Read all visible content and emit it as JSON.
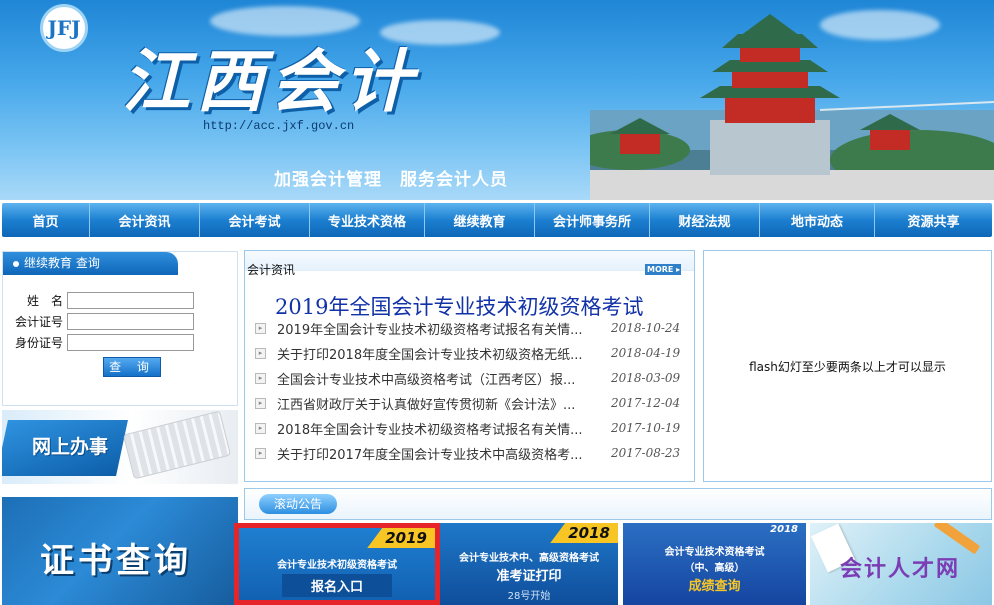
{
  "header": {
    "logo_text": "JFJ",
    "title": "江西会计",
    "url": "http://acc.jxf.gov.cn",
    "slogan": "加强会计管理　服务会计人员"
  },
  "nav": {
    "items": [
      {
        "label": "首页"
      },
      {
        "label": "会计资讯"
      },
      {
        "label": "会计考试"
      },
      {
        "label": "专业技术资格"
      },
      {
        "label": "继续教育"
      },
      {
        "label": "会计师事务所"
      },
      {
        "label": "财经法规"
      },
      {
        "label": "地市动态"
      },
      {
        "label": "资源共享"
      }
    ]
  },
  "query": {
    "title": "继续教育 查询",
    "fields": [
      {
        "label": "姓　名",
        "value": ""
      },
      {
        "label": "会计证号",
        "value": ""
      },
      {
        "label": "身份证号",
        "value": ""
      }
    ],
    "button": "查 询"
  },
  "online_banner": {
    "label": "网上办事"
  },
  "cert_banner": {
    "label": "证书查询"
  },
  "news": {
    "title": "会计资讯",
    "more": "MORE ▸",
    "headline": "2019年全国会计专业技术初级资格考试",
    "items": [
      {
        "title": "2019年全国会计专业技术初级资格考试报名有关情...",
        "date": "2018-10-24"
      },
      {
        "title": "关于打印2018年度全国会计专业技术初级资格无纸...",
        "date": "2018-04-19"
      },
      {
        "title": "全国会计专业技术中高级资格考试（江西考区）报...",
        "date": "2018-03-09"
      },
      {
        "title": "江西省财政厅关于认真做好宣传贯彻新《会计法》...",
        "date": "2017-12-04"
      },
      {
        "title": "2018年全国会计专业技术初级资格考试报名有关情...",
        "date": "2017-10-19"
      },
      {
        "title": "关于打印2017年度全国会计专业技术中高级资格考...",
        "date": "2017-08-23"
      }
    ]
  },
  "flash": {
    "text": "flash幻灯至少要两条以上才可以显示"
  },
  "notice": {
    "label": "滚动公告"
  },
  "banners": [
    {
      "year": "2019",
      "line1": "会计专业技术初级资格考试",
      "line2": "报名入口",
      "line3": ""
    },
    {
      "year": "2018",
      "line1": "会计专业技术中、高级资格考试",
      "line2": "准考证打印",
      "line3": "28号开始"
    },
    {
      "year": "2018",
      "line1": "会计专业技术资格考试",
      "line2": "（中、高级）",
      "line3": "成绩查询"
    },
    {
      "year": "",
      "line1": "",
      "line2": "会计人才网",
      "line3": ""
    }
  ],
  "colors": {
    "nav_blue": "#1c7fd0",
    "headline_blue": "#1232a8",
    "highlight_red": "#e5252a",
    "year_yellow": "#f7c625"
  }
}
